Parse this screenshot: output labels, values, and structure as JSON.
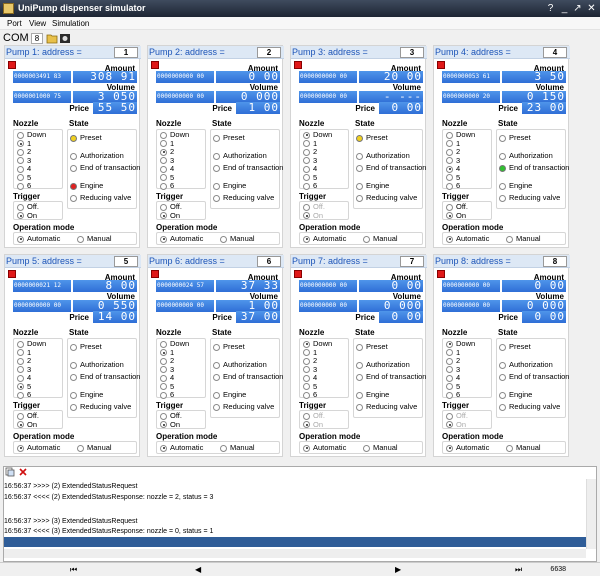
{
  "window": {
    "title": "UniPump dispenser simulator"
  },
  "menu": [
    "Port",
    "View",
    "Simulation"
  ],
  "toolbar": {
    "com_label": "COM",
    "com_value": "8"
  },
  "labels": {
    "amount": "Amount",
    "volume": "Volume",
    "price": "Price",
    "nozzle": "Nozzle",
    "state": "State",
    "trigger": "Trigger",
    "operation_mode": "Operation mode"
  },
  "nozzle_options": [
    "Down",
    "1",
    "2",
    "3",
    "4",
    "5",
    "6"
  ],
  "state_options": [
    "Preset",
    "Authorization",
    "End of transaction",
    "Engine",
    "Reducing valve"
  ],
  "trigger_options": [
    "Off.",
    "On"
  ],
  "opmode_options": [
    "Automatic",
    "Manual"
  ],
  "pumps": [
    {
      "title": "Pump 1: address =",
      "address": "1",
      "amount_small": "0000003491 83",
      "amount_big": "308 91",
      "volume_small": "0000001000 75",
      "volume_big": "3 050",
      "price": "55 50",
      "nozzle": "1",
      "preset_led": "#f0d020",
      "engine_led": "#e02020",
      "eot_led": "",
      "trigger": "On",
      "trigger_enabled": true
    },
    {
      "title": "Pump 2: address =",
      "address": "2",
      "amount_small": "0000000000 00",
      "amount_big": "0 00",
      "volume_small": "0000000000 00",
      "volume_big": "0 000",
      "price": "1 00",
      "nozzle": "2",
      "preset_led": "",
      "engine_led": "",
      "eot_led": "",
      "trigger": "On",
      "trigger_enabled": true
    },
    {
      "title": "Pump 3: address =",
      "address": "3",
      "amount_small": "0000000000 00",
      "amount_big": "20 00",
      "volume_small": "0000000000 00",
      "volume_big": "- ---",
      "price": "0 00",
      "nozzle": "Down",
      "preset_led": "#f0d020",
      "engine_led": "",
      "eot_led": "",
      "trigger": "On",
      "trigger_enabled": false
    },
    {
      "title": "Pump 4: address =",
      "address": "4",
      "amount_small": "0000000053 61",
      "amount_big": "3 50",
      "volume_small": "0000000000 20",
      "volume_big": "0 150",
      "price": "23 00",
      "nozzle": "4",
      "preset_led": "",
      "engine_led": "",
      "eot_led": "#30c030",
      "trigger": "On",
      "trigger_enabled": true
    },
    {
      "title": "Pump 5: address =",
      "address": "5",
      "amount_small": "0000000021 12",
      "amount_big": "8 00",
      "volume_small": "0000000000 00",
      "volume_big": "0 550",
      "price": "14 00",
      "nozzle": "5",
      "preset_led": "",
      "engine_led": "",
      "eot_led": "",
      "trigger": "On",
      "trigger_enabled": true
    },
    {
      "title": "Pump 6: address =",
      "address": "6",
      "amount_small": "0000000024 57",
      "amount_big": "37 33",
      "volume_small": "0000000000 00",
      "volume_big": "1 00",
      "price": "37 00",
      "nozzle": "1",
      "preset_led": "",
      "engine_led": "",
      "eot_led": "",
      "trigger": "On",
      "trigger_enabled": true
    },
    {
      "title": "Pump 7: address =",
      "address": "7",
      "amount_small": "0000000000 00",
      "amount_big": "0 00",
      "volume_small": "0000000000 00",
      "volume_big": "0 000",
      "price": "0 00",
      "nozzle": "Down",
      "preset_led": "",
      "engine_led": "",
      "eot_led": "",
      "trigger": "On",
      "trigger_enabled": false
    },
    {
      "title": "Pump 8: address =",
      "address": "8",
      "amount_small": "0000000000 00",
      "amount_big": "0 00",
      "volume_small": "0000000000 00",
      "volume_big": "0 000",
      "price": "0 00",
      "nozzle": "Down",
      "preset_led": "",
      "engine_led": "",
      "eot_led": "",
      "trigger": "On",
      "trigger_enabled": false
    }
  ],
  "log": {
    "lines": [
      "16:56:37 >>>> (2) ExtendedStatusRequest",
      "16:56:37 <<<< (2) ExtendedStatusResponse: nozzle = 2, status = 3",
      "",
      "16:56:37 >>>> (3) ExtendedStatusRequest",
      "16:56:37 <<<< (3) ExtendedStatusResponse: nozzle = 0, status = 1"
    ],
    "count": "6638"
  }
}
